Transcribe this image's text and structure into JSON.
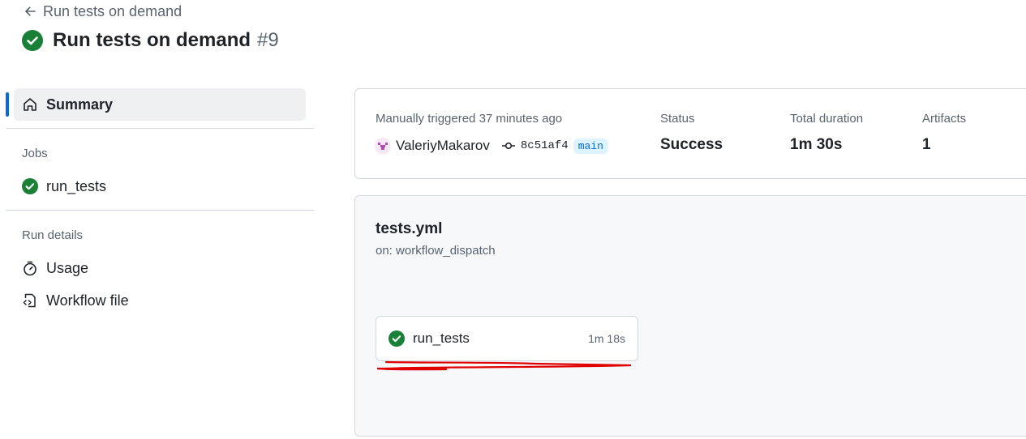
{
  "header": {
    "back_label": "Run tests on demand",
    "title": "Run tests on demand",
    "run_number": "#9"
  },
  "sidebar": {
    "summary_label": "Summary",
    "jobs_heading": "Jobs",
    "jobs": [
      {
        "label": "run_tests",
        "status": "success"
      }
    ],
    "run_details_heading": "Run details",
    "details": [
      {
        "label": "Usage",
        "icon": "stopwatch-icon"
      },
      {
        "label": "Workflow file",
        "icon": "file-code-icon"
      }
    ]
  },
  "summary": {
    "trigger_text": "Manually triggered 37 minutes ago",
    "user": "ValeriyMakarov",
    "commit_sha": "8c51af4",
    "branch": "main",
    "status_label": "Status",
    "status_value": "Success",
    "duration_label": "Total duration",
    "duration_value": "1m 30s",
    "artifacts_label": "Artifacts",
    "artifacts_value": "1"
  },
  "workflow": {
    "file": "tests.yml",
    "trigger": "on: workflow_dispatch",
    "job": {
      "name": "run_tests",
      "duration": "1m 18s"
    }
  },
  "colors": {
    "success": "#1a7f37",
    "accent": "#0969da",
    "annotation": "#e00000"
  }
}
